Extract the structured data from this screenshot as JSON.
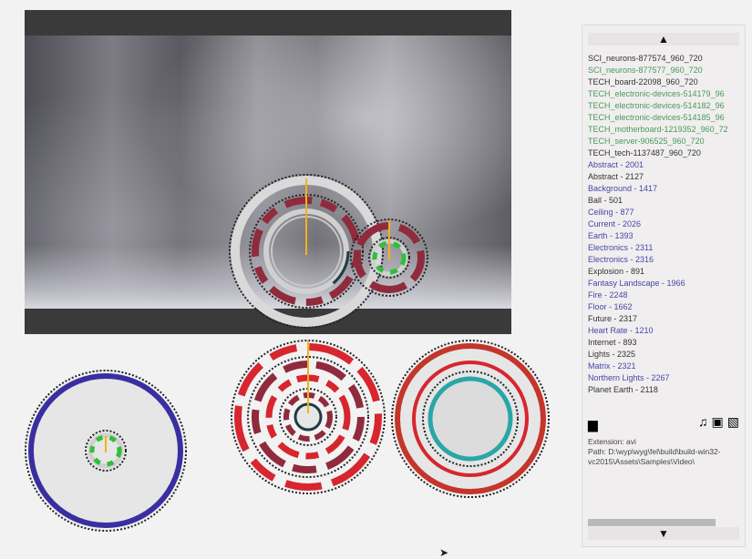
{
  "files": [
    {
      "label": "SCI_neurons-877574_960_720",
      "color": "#333333"
    },
    {
      "label": "SCI_neurons-877577_960_720",
      "color": "#4a9a5a"
    },
    {
      "label": "TECH_board-22098_960_720",
      "color": "#333333"
    },
    {
      "label": "TECH_electronic-devices-514179_96",
      "color": "#4a9a5a"
    },
    {
      "label": "TECH_electronic-devices-514182_96",
      "color": "#4a9a5a"
    },
    {
      "label": "TECH_electronic-devices-514185_96",
      "color": "#4a9a5a"
    },
    {
      "label": "TECH_motherboard-1219352_960_72",
      "color": "#4a9a5a"
    },
    {
      "label": "TECH_server-906525_960_720",
      "color": "#4a9a5a"
    },
    {
      "label": "TECH_tech-1137487_960_720",
      "color": "#333333"
    },
    {
      "label": "Abstract - 2001",
      "color": "#4646a8"
    },
    {
      "label": "Abstract - 2127",
      "color": "#333333"
    },
    {
      "label": "Background - 1417",
      "color": "#4646a8"
    },
    {
      "label": "Ball - 501",
      "color": "#333333"
    },
    {
      "label": "Ceiling - 877",
      "color": "#4646a8"
    },
    {
      "label": "Current - 2026",
      "color": "#4646a8"
    },
    {
      "label": "Earth - 1393",
      "color": "#4646a8"
    },
    {
      "label": "Electronics - 2311",
      "color": "#4646a8"
    },
    {
      "label": "Electronics - 2316",
      "color": "#4646a8"
    },
    {
      "label": "Explosion - 891",
      "color": "#333333"
    },
    {
      "label": "Fantasy Landscape - 1966",
      "color": "#4646a8"
    },
    {
      "label": "Fire - 2248",
      "color": "#4646a8"
    },
    {
      "label": "Floor - 1662",
      "color": "#4646a8"
    },
    {
      "label": "Future - 2317",
      "color": "#333333"
    },
    {
      "label": "Heart Rate - 1210",
      "color": "#4646a8"
    },
    {
      "label": "Internet - 893",
      "color": "#333333"
    },
    {
      "label": "Lights - 2325",
      "color": "#333333"
    },
    {
      "label": "Matrix - 2321",
      "color": "#4646a8"
    },
    {
      "label": "Northern Lights - 2267",
      "color": "#4646a8"
    },
    {
      "label": "Planet Earth - 2118",
      "color": "#333333"
    }
  ],
  "panel": {
    "scroll_up": "▲",
    "scroll_down": "▼",
    "extension": "Extension: avi",
    "path": "Path: D:\\wyp\\wyg\\fel\\build\\build-win32-vc2015\\Assets\\Samples\\Video\\",
    "icons": [
      "folder-icon",
      "music-icon",
      "video-icon",
      "image-icon"
    ]
  },
  "colors": {
    "accent_blue": "#3a2fa0",
    "accent_red": "#d7262e",
    "dark_red": "#8f2b3c",
    "teal": "#2aa6a6",
    "green": "#2fbf3a",
    "needle": "#f1b21a"
  }
}
